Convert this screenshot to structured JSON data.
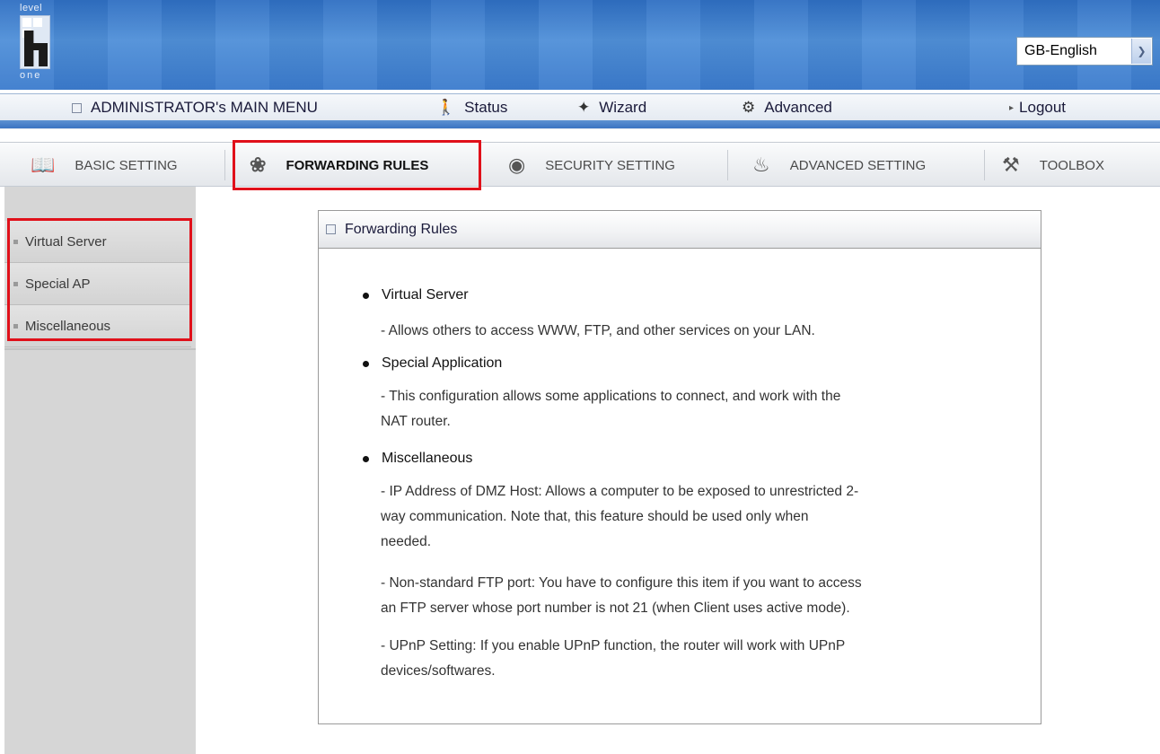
{
  "brand": {
    "logo_top": "level",
    "logo_bottom": "one"
  },
  "language": {
    "selected": "GB-English"
  },
  "main_menu": {
    "title": "ADMINISTRATOR's MAIN MENU",
    "status": "Status",
    "wizard": "Wizard",
    "advanced": "Advanced",
    "logout": "Logout"
  },
  "tabs": [
    {
      "label": "BASIC SETTING",
      "icon": "book-icon"
    },
    {
      "label": "FORWARDING RULES",
      "icon": "forwarding-icon",
      "active": true
    },
    {
      "label": "SECURITY SETTING",
      "icon": "security-icon"
    },
    {
      "label": "ADVANCED SETTING",
      "icon": "advanced-icon"
    },
    {
      "label": "TOOLBOX",
      "icon": "toolbox-icon"
    }
  ],
  "sidebar": {
    "items": [
      {
        "label": "Virtual Server"
      },
      {
        "label": "Special AP"
      },
      {
        "label": "Miscellaneous"
      }
    ]
  },
  "panel": {
    "title": "Forwarding Rules",
    "sections": [
      {
        "heading": "Virtual Server",
        "lines": [
          "Allows others to access WWW, FTP, and other services on your LAN."
        ]
      },
      {
        "heading": "Special Application",
        "lines": [
          "This configuration allows some applications to connect, and work with the",
          "NAT router."
        ]
      },
      {
        "heading": "Miscellaneous",
        "lines": [
          "IP Address of DMZ Host: Allows a computer to be exposed to unrestricted 2-",
          "way communication. Note that, this feature should be used only when",
          "needed.",
          "Non-standard FTP port: You have to configure this item if you want to access",
          "an FTP server whose port number is not 21 (when Client uses active mode).",
          "UPnP Setting: If you enable UPnP function, the router will work with UPnP",
          "devices/softwares."
        ]
      }
    ]
  },
  "colors": {
    "header_blue": "#3b7bcd",
    "highlight_red": "#e0101a",
    "sidebar_gray": "#d6d6d6"
  }
}
